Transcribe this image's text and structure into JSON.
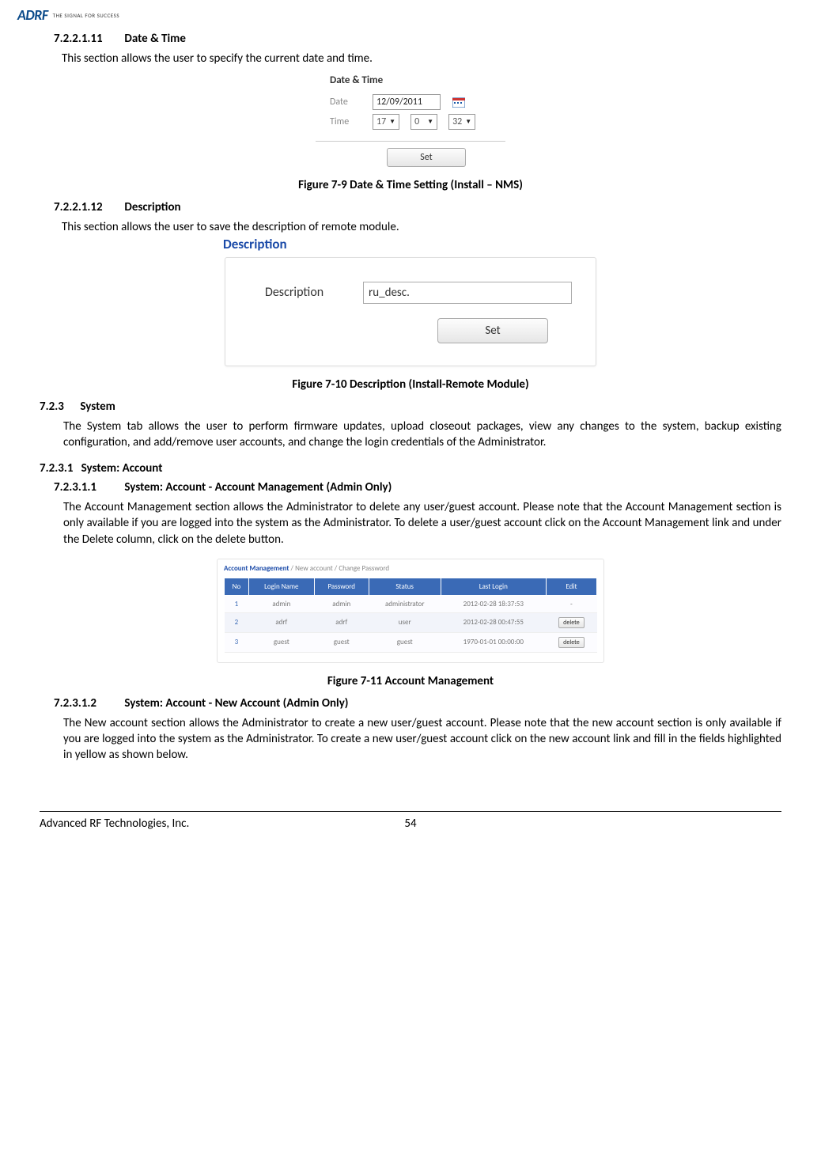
{
  "logo": {
    "brand": "ADRF",
    "tagline": "THE SIGNAL FOR SUCCESS"
  },
  "sections": {
    "s1": {
      "num": "7.2.2.1.11",
      "title": "Date & Time",
      "body": "This section allows the user to specify the current date and time."
    },
    "s2": {
      "num": "7.2.2.1.12",
      "title": "Description",
      "body": "This section allows the user to save the description of remote module."
    },
    "s3": {
      "num": "7.2.3",
      "title": "System",
      "body": "The System tab allows the user to perform firmware updates, upload closeout packages, view any changes to the system, backup existing configuration, and add/remove user accounts, and change the login credentials of the Administrator."
    },
    "s4": {
      "num": "7.2.3.1",
      "title": "System: Account"
    },
    "s5": {
      "num": "7.2.3.1.1",
      "title": "System: Account - Account Management (Admin Only)",
      "body": "The Account Management section allows the Administrator to delete any user/guest account.  Please note that the Account Management section is only available if you are logged into the system as the Administrator.  To delete a user/guest account click on the Account Management link and under the Delete column, click on the delete button."
    },
    "s6": {
      "num": "7.2.3.1.2",
      "title": "System: Account - New Account (Admin Only)",
      "body": "The New account section allows the Administrator to create a new user/guest account.  Please note that the new account section is only available if you are logged into the system as the Administrator.  To create a new user/guest account click on the new account link and fill in the fields highlighted in yellow as shown below."
    }
  },
  "captions": {
    "c1": "Figure 7-9     Date & Time Setting (Install – NMS)",
    "c2": "Figure 7-10   Description (Install-Remote Module)",
    "c3": "Figure 7-11   Account Management"
  },
  "datetime": {
    "panel_title": "Date & Time",
    "date_label": "Date",
    "date_value": "12/09/2011",
    "time_label": "Time",
    "hour": "17",
    "minute": "0",
    "second": "32",
    "set_btn": "Set"
  },
  "description_panel": {
    "heading": "Description",
    "label": "Description",
    "value": "ru_desc.",
    "set_btn": "Set"
  },
  "account": {
    "crumbs": {
      "active": "Account Management",
      "sep1": " / ",
      "inactive1": "New account",
      "sep2": " / ",
      "inactive2": "Change Password"
    },
    "headers": [
      "No",
      "Login Name",
      "Password",
      "Status",
      "Last Login",
      "Edit"
    ],
    "rows": [
      {
        "no": "1",
        "login": "admin",
        "pw": "admin",
        "status": "administrator",
        "last": "2012-02-28 18:37:53",
        "edit": "-"
      },
      {
        "no": "2",
        "login": "adrf",
        "pw": "adrf",
        "status": "user",
        "last": "2012-02-28 00:47:55",
        "edit": "delete"
      },
      {
        "no": "3",
        "login": "guest",
        "pw": "guest",
        "status": "guest",
        "last": "1970-01-01 00:00:00",
        "edit": "delete"
      }
    ]
  },
  "footer": {
    "company": "Advanced RF Technologies, Inc.",
    "page": "54"
  }
}
